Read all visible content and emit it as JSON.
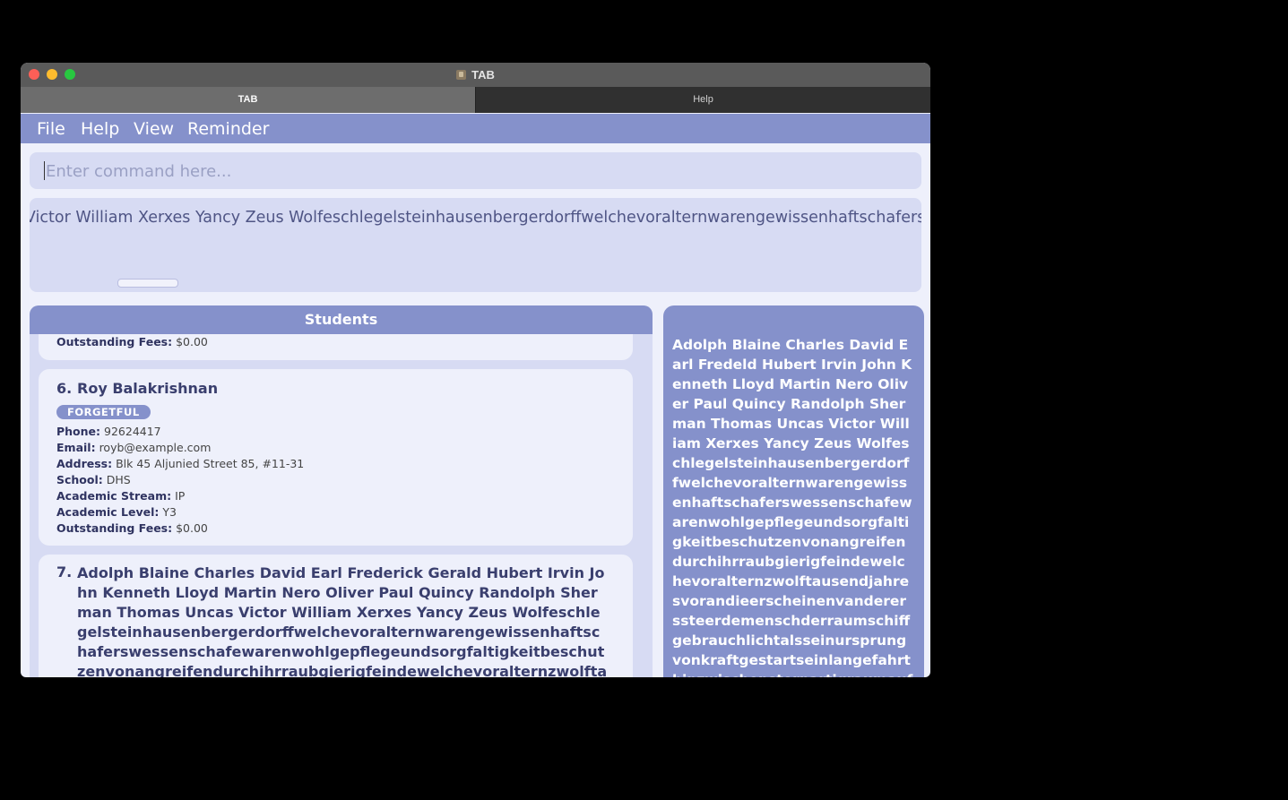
{
  "window": {
    "title": "TAB",
    "tabs": [
      {
        "label": "TAB",
        "active": true
      },
      {
        "label": "Help",
        "active": false
      }
    ]
  },
  "menu": {
    "items": [
      "File",
      "Help",
      "View",
      "Reminder"
    ]
  },
  "command": {
    "placeholder": "Enter command here...",
    "value": ""
  },
  "result": {
    "text": "Uncas Victor William Xerxes Yancy Zeus Wolfeschlegelsteinhausenbergerdorffwelchevoralternwarengewissenhaftschaferswessen"
  },
  "students": {
    "header": "Students",
    "partial_card": {
      "fees_label": "Outstanding Fees:",
      "fees_value": "$0.00"
    },
    "card6": {
      "index": "6.",
      "name": "Roy Balakrishnan",
      "tag": "FORGETFUL",
      "phone_label": "Phone:",
      "phone": "92624417",
      "email_label": "Email:",
      "email": "royb@example.com",
      "address_label": "Address:",
      "address": "Blk 45 Aljunied Street 85, #11-31",
      "school_label": "School:",
      "school": "DHS",
      "stream_label": "Academic Stream:",
      "stream": "IP",
      "level_label": "Academic Level:",
      "level": "Y3",
      "fees_label": "Outstanding Fees:",
      "fees": "$0.00"
    },
    "card7": {
      "index": "7.",
      "name": "Adolph Blaine Charles David Earl Frederick Gerald Hubert Irvin John Kenneth Lloyd Martin Nero Oliver Paul Quincy Randolph Sherman Thomas Uncas Victor William Xerxes Yancy Zeus Wolfeschlegelsteinhausenbergerdorffwelchevoralternwarengewissenhaftschaferswessenschafewarenwohlgepflegeundsorgfaltigkeitbeschutzenvonangreifendurchihrraubgierigfeindewelchevoralternzwolftausendjahresvorandieerscheinen"
    }
  },
  "detail": {
    "text": "Adolph Blaine Charles David Earl Fredeld Hubert Irvin John Kenneth Lloyd Martin Nero Oliver Paul Quincy Randolph Sherman Thomas Uncas Victor William Xerxes Yancy Zeus Wolfeschlegelsteinhausenbergerdorffwelchevoralternwarengewissenhaftschaferswessenschafewarenwohlgepflegeundsorgfaltigkeitbeschutzenvonangreifendurchihrraubgierigfeindewelchevoralternzwolftausendjahresvorandieerscheinenvandererssteerdemenschderraumschiffgebrauchlichtalsseinursprungvonkraftgestartseinlangefahrthinzwischensternartigraumaufdersuchenachdiesternwelchegehabtbewohnbar"
  }
}
